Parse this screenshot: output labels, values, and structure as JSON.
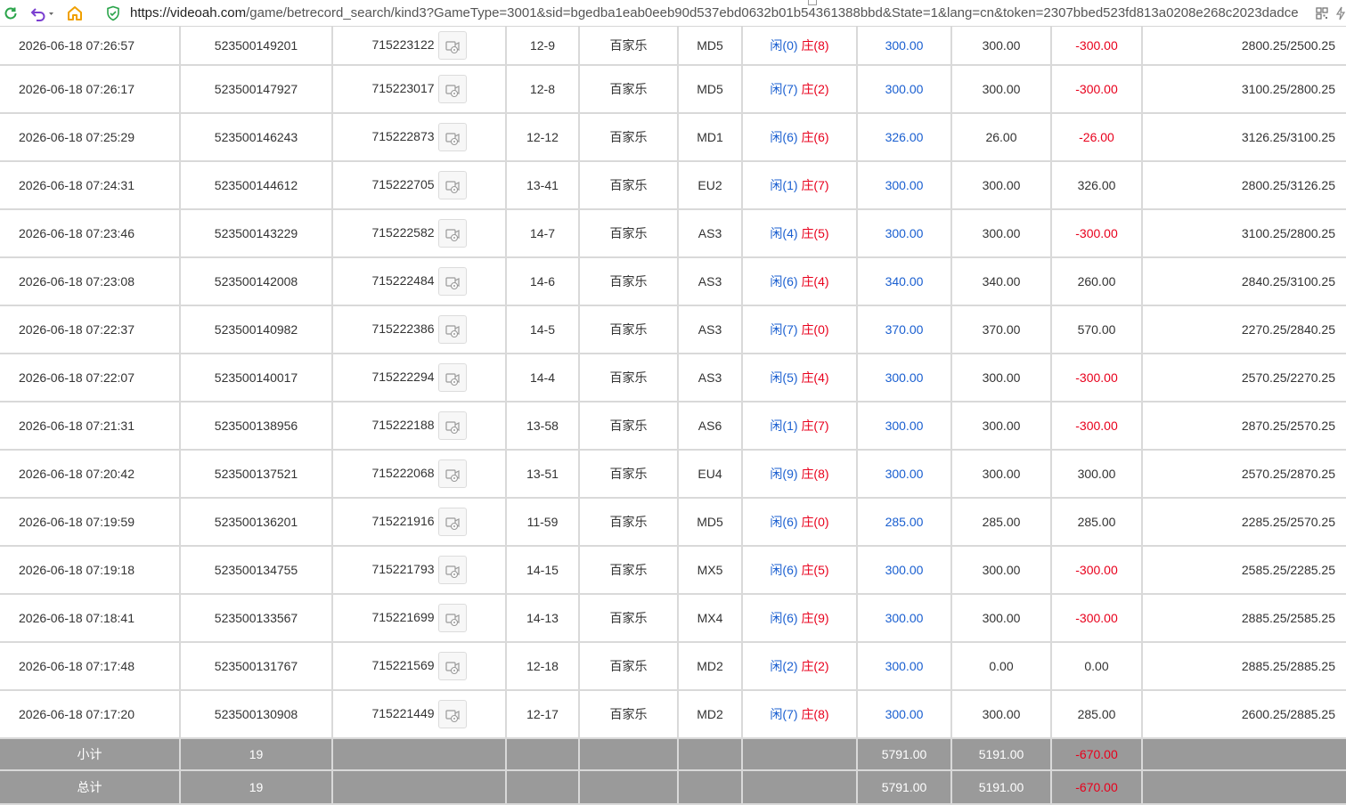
{
  "browser": {
    "url_scheme": "https://",
    "url_host": "videoah.com",
    "url_rest": "/game/betrecord_search/kind3?GameType=3001&sid=bgedba1eab0eeb90d537ebd0632b01b54361388bbd&State=1&lang=cn&token=2307bbed523fd813a0208e268c2023dadce",
    "icons": [
      "refresh-icon",
      "undo-icon",
      "home-icon",
      "shield-icon",
      "qr-code-icon",
      "lightning-icon"
    ]
  },
  "rows": [
    {
      "time": "2026-06-18 07:26:57",
      "bet_id": "523500149201",
      "round_id": "715223122",
      "shoe": "12-9",
      "game": "百家乐",
      "table": "MD5",
      "player": "闲(0)",
      "banker": "庄(8)",
      "bet": "300.00",
      "valid": "300.00",
      "win": "-300.00",
      "win_neg": true,
      "balance": "2800.25/2500.25"
    },
    {
      "time": "2026-06-18 07:26:17",
      "bet_id": "523500147927",
      "round_id": "715223017",
      "shoe": "12-8",
      "game": "百家乐",
      "table": "MD5",
      "player": "闲(7)",
      "banker": "庄(2)",
      "bet": "300.00",
      "valid": "300.00",
      "win": "-300.00",
      "win_neg": true,
      "balance": "3100.25/2800.25"
    },
    {
      "time": "2026-06-18 07:25:29",
      "bet_id": "523500146243",
      "round_id": "715222873",
      "shoe": "12-12",
      "game": "百家乐",
      "table": "MD1",
      "player": "闲(6)",
      "banker": "庄(6)",
      "bet": "326.00",
      "valid": "26.00",
      "win": "-26.00",
      "win_neg": true,
      "balance": "3126.25/3100.25"
    },
    {
      "time": "2026-06-18 07:24:31",
      "bet_id": "523500144612",
      "round_id": "715222705",
      "shoe": "13-41",
      "game": "百家乐",
      "table": "EU2",
      "player": "闲(1)",
      "banker": "庄(7)",
      "bet": "300.00",
      "valid": "300.00",
      "win": "326.00",
      "win_neg": false,
      "balance": "2800.25/3126.25"
    },
    {
      "time": "2026-06-18 07:23:46",
      "bet_id": "523500143229",
      "round_id": "715222582",
      "shoe": "14-7",
      "game": "百家乐",
      "table": "AS3",
      "player": "闲(4)",
      "banker": "庄(5)",
      "bet": "300.00",
      "valid": "300.00",
      "win": "-300.00",
      "win_neg": true,
      "balance": "3100.25/2800.25"
    },
    {
      "time": "2026-06-18 07:23:08",
      "bet_id": "523500142008",
      "round_id": "715222484",
      "shoe": "14-6",
      "game": "百家乐",
      "table": "AS3",
      "player": "闲(6)",
      "banker": "庄(4)",
      "bet": "340.00",
      "valid": "340.00",
      "win": "260.00",
      "win_neg": false,
      "balance": "2840.25/3100.25"
    },
    {
      "time": "2026-06-18 07:22:37",
      "bet_id": "523500140982",
      "round_id": "715222386",
      "shoe": "14-5",
      "game": "百家乐",
      "table": "AS3",
      "player": "闲(7)",
      "banker": "庄(0)",
      "bet": "370.00",
      "valid": "370.00",
      "win": "570.00",
      "win_neg": false,
      "balance": "2270.25/2840.25"
    },
    {
      "time": "2026-06-18 07:22:07",
      "bet_id": "523500140017",
      "round_id": "715222294",
      "shoe": "14-4",
      "game": "百家乐",
      "table": "AS3",
      "player": "闲(5)",
      "banker": "庄(4)",
      "bet": "300.00",
      "valid": "300.00",
      "win": "-300.00",
      "win_neg": true,
      "balance": "2570.25/2270.25"
    },
    {
      "time": "2026-06-18 07:21:31",
      "bet_id": "523500138956",
      "round_id": "715222188",
      "shoe": "13-58",
      "game": "百家乐",
      "table": "AS6",
      "player": "闲(1)",
      "banker": "庄(7)",
      "bet": "300.00",
      "valid": "300.00",
      "win": "-300.00",
      "win_neg": true,
      "balance": "2870.25/2570.25"
    },
    {
      "time": "2026-06-18 07:20:42",
      "bet_id": "523500137521",
      "round_id": "715222068",
      "shoe": "13-51",
      "game": "百家乐",
      "table": "EU4",
      "player": "闲(9)",
      "banker": "庄(8)",
      "bet": "300.00",
      "valid": "300.00",
      "win": "300.00",
      "win_neg": false,
      "balance": "2570.25/2870.25"
    },
    {
      "time": "2026-06-18 07:19:59",
      "bet_id": "523500136201",
      "round_id": "715221916",
      "shoe": "11-59",
      "game": "百家乐",
      "table": "MD5",
      "player": "闲(6)",
      "banker": "庄(0)",
      "bet": "285.00",
      "valid": "285.00",
      "win": "285.00",
      "win_neg": false,
      "balance": "2285.25/2570.25"
    },
    {
      "time": "2026-06-18 07:19:18",
      "bet_id": "523500134755",
      "round_id": "715221793",
      "shoe": "14-15",
      "game": "百家乐",
      "table": "MX5",
      "player": "闲(6)",
      "banker": "庄(5)",
      "bet": "300.00",
      "valid": "300.00",
      "win": "-300.00",
      "win_neg": true,
      "balance": "2585.25/2285.25"
    },
    {
      "time": "2026-06-18 07:18:41",
      "bet_id": "523500133567",
      "round_id": "715221699",
      "shoe": "14-13",
      "game": "百家乐",
      "table": "MX4",
      "player": "闲(6)",
      "banker": "庄(9)",
      "bet": "300.00",
      "valid": "300.00",
      "win": "-300.00",
      "win_neg": true,
      "balance": "2885.25/2585.25"
    },
    {
      "time": "2026-06-18 07:17:48",
      "bet_id": "523500131767",
      "round_id": "715221569",
      "shoe": "12-18",
      "game": "百家乐",
      "table": "MD2",
      "player": "闲(2)",
      "banker": "庄(2)",
      "bet": "300.00",
      "valid": "0.00",
      "win": "0.00",
      "win_neg": false,
      "balance": "2885.25/2885.25"
    },
    {
      "time": "2026-06-18 07:17:20",
      "bet_id": "523500130908",
      "round_id": "715221449",
      "shoe": "12-17",
      "game": "百家乐",
      "table": "MD2",
      "player": "闲(7)",
      "banker": "庄(8)",
      "bet": "300.00",
      "valid": "300.00",
      "win": "285.00",
      "win_neg": false,
      "balance": "2600.25/2885.25"
    }
  ],
  "subtotal": {
    "label": "小计",
    "count": "19",
    "bet": "5791.00",
    "valid": "5191.00",
    "win": "-670.00"
  },
  "total": {
    "label": "总计",
    "count": "19",
    "bet": "5791.00",
    "valid": "5191.00",
    "win": "-670.00"
  },
  "colors": {
    "bet": "#1a5fd0",
    "loss": "#e8001c",
    "player": "#1a5fd0",
    "banker": "#e8001c",
    "summary_bg": "#9a9a9a"
  }
}
